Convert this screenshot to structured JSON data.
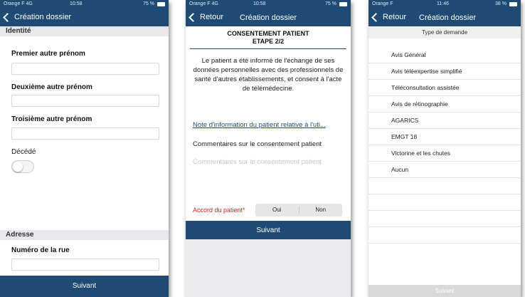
{
  "colors": {
    "nav_bg": "#1e4a73",
    "accent_red": "#e02020",
    "link": "#1e4a73"
  },
  "phone1": {
    "status": {
      "carrier": "Orange F 4G",
      "time": "10:58",
      "battery": "75 %"
    },
    "nav": {
      "title": "Création dossier"
    },
    "section_identite": "Identité",
    "premier_label": "Premier autre prénom",
    "deuxieme_label": "Deuxième autre prénom",
    "troisieme_label": "Troisième autre prénom",
    "decede_label": "Décédé",
    "section_adresse": "Adresse",
    "rue_label": "Numéro de la rue",
    "submit_label": "Suivant"
  },
  "phone2": {
    "status": {
      "carrier": "Orange F 4G",
      "time": "10:58",
      "battery": "75 %"
    },
    "nav": {
      "back_label": "Retour",
      "title": "Création dossier"
    },
    "heading_line1": "CONSENTEMENT PATIENT",
    "heading_line2": "ETAPE 2/2",
    "consent_text": "Le patient a été informé de l'échange de ses données personnelles avec des professionnels de santé d'autres établissements, et consent à l'acte de télémédecine.",
    "info_link": "Note d'information du patient relative à l'uti...",
    "comments_label": "Commentaires sur le consentement patient",
    "comments_placeholder": "Commentaires sur le consentement patient",
    "accord_label": "Accord du patient*",
    "oui_label": "Oui",
    "non_label": "Non",
    "submit_label": "Suivant"
  },
  "phone3": {
    "status": {
      "carrier": "Orange F",
      "time": "11:46",
      "battery": "38 %"
    },
    "nav": {
      "back_label": "Retour",
      "title": "Création dossier"
    },
    "list_header": "Type de demande",
    "items": [
      "Avis Général",
      "Avis téléexpertise simplifié",
      "Téléconsultation assistée",
      "Avis de rétinographie",
      "AGARICS",
      "EMGT 18",
      "Victorine et les chutes",
      "Aucun"
    ],
    "submit_label": "Suivant"
  }
}
